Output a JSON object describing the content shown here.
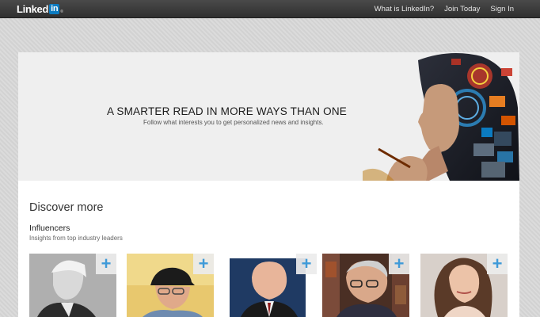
{
  "header": {
    "logo_text": "Linked",
    "logo_in": "in",
    "logo_reg": "®",
    "nav": [
      {
        "label": "What is LinkedIn?"
      },
      {
        "label": "Join Today"
      },
      {
        "label": "Sign In"
      }
    ]
  },
  "hero": {
    "title": "A SMARTER READ IN MORE WAYS THAN ONE",
    "subtitle": "Follow what interests you to get personalized news and insights."
  },
  "discover": {
    "heading": "Discover more",
    "section_title": "Influencers",
    "section_subtitle": "Insights from top industry leaders"
  },
  "influencers": [
    {
      "follow_label": "+"
    },
    {
      "follow_label": "+"
    },
    {
      "follow_label": "+"
    },
    {
      "follow_label": "+"
    },
    {
      "follow_label": "+"
    }
  ],
  "colors": {
    "brand": "#0b7bc1",
    "topbar": "#3a3a3a",
    "plus": "#3f9ad8"
  }
}
